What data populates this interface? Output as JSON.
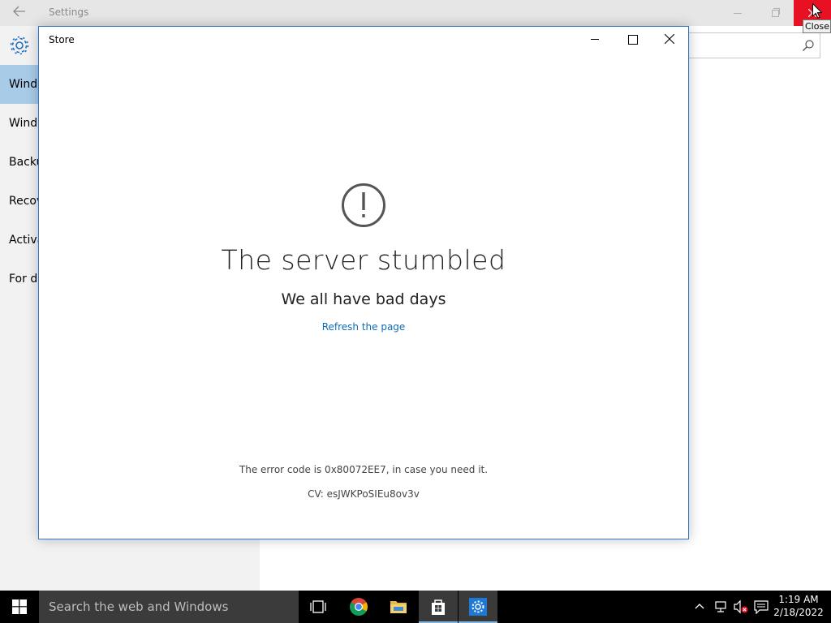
{
  "settings": {
    "title": "Settings",
    "back_icon": "back-arrow-icon",
    "sidebar_items": [
      {
        "label": "Wind",
        "selected": true
      },
      {
        "label": "Wind",
        "selected": false
      },
      {
        "label": "Backu",
        "selected": false
      },
      {
        "label": "Recov",
        "selected": false
      },
      {
        "label": "Activa",
        "selected": false
      },
      {
        "label": "For de",
        "selected": false
      }
    ],
    "accent_color": "#2b79c4",
    "selected_color": "#a8cbe8",
    "close_button_color": "#e81123"
  },
  "tooltip": {
    "text": "Close"
  },
  "store": {
    "title": "Store",
    "error_heading": "The server stumbled",
    "error_subheading": "We all have bad days",
    "refresh_link": "Refresh the page",
    "error_code": "The error code is 0x80072EE7, in case you need it.",
    "cv": "CV: esJWKPoSIEu8ov3v",
    "link_color": "#0e6cb5"
  },
  "taskbar": {
    "search_placeholder": "Search the web and Windows",
    "apps": [
      "task-view-icon",
      "chrome-icon",
      "file-explorer-icon",
      "store-icon",
      "settings-icon"
    ],
    "clock_time": "1:19 AM",
    "clock_date": "2/18/2022"
  }
}
